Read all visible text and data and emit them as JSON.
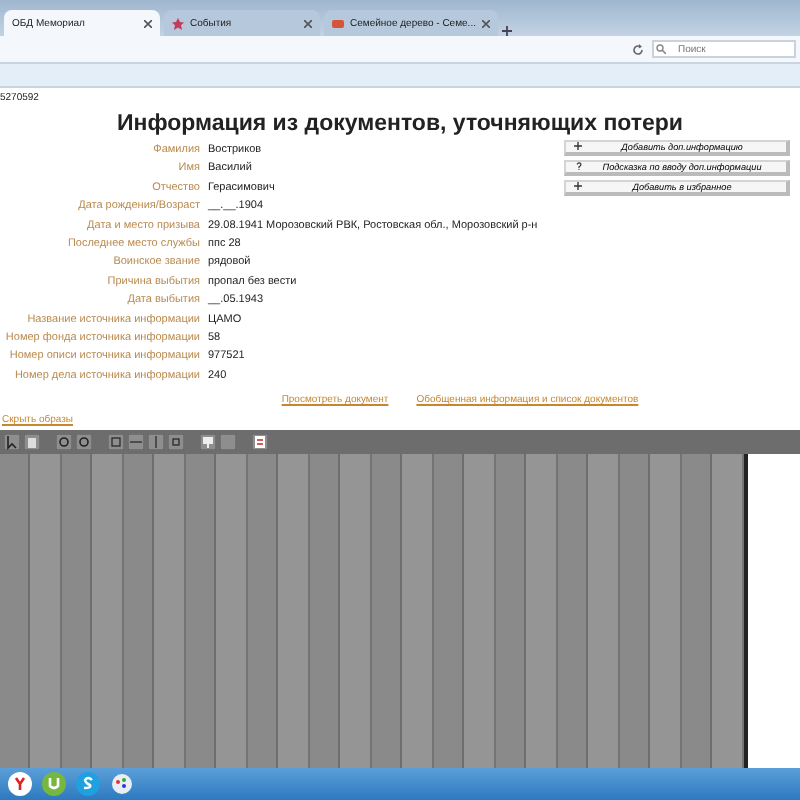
{
  "browser": {
    "tabs": [
      {
        "label": "ОБД Мемориал",
        "selected": true
      },
      {
        "label": "События",
        "selected": false
      },
      {
        "label": "Семейное дерево - Семе...",
        "selected": false
      }
    ],
    "search": {
      "placeholder": "Поиск"
    }
  },
  "page": {
    "record_id": "5270592",
    "title": "Информация из документов, уточняющих потери",
    "fields": [
      {
        "label": "Фамилия",
        "value": "Востриков"
      },
      {
        "label": "Имя",
        "value": "Василий"
      },
      {
        "label": "Отчество",
        "value": "Герасимович"
      },
      {
        "label": "Дата рождения/Возраст",
        "value": "__.__.1904"
      },
      {
        "label": "Дата и место призыва",
        "value": "29.08.1941 Морозовский РВК, Ростовская обл., Морозовский р-н"
      },
      {
        "label": "Последнее место службы",
        "value": "ппс 28"
      },
      {
        "label": "Воинское звание",
        "value": "рядовой"
      },
      {
        "label": "Причина выбытия",
        "value": "пропал без вести"
      },
      {
        "label": "Дата выбытия",
        "value": "__.05.1943"
      },
      {
        "label": "Название источника информации",
        "value": "ЦАМО"
      },
      {
        "label": "Номер фонда источника информации",
        "value": "58"
      },
      {
        "label": "Номер описи источника информации",
        "value": "977521"
      },
      {
        "label": "Номер дела источника информации",
        "value": "240"
      }
    ],
    "actions": [
      {
        "kind": "add",
        "label": "Добавить доп.информацию"
      },
      {
        "kind": "help",
        "label": "Подсказка по вводу доп.информации"
      },
      {
        "kind": "add",
        "label": "Добавить в избранное"
      }
    ],
    "links": [
      "Просмотреть документ",
      "Обобщенная информация и список документов"
    ],
    "hide_link": "Скрыть образы"
  }
}
